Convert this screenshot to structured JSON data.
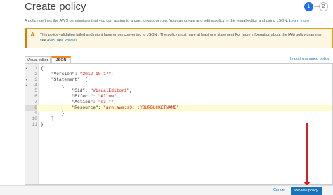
{
  "page": {
    "title": "Create policy"
  },
  "steps": {
    "step1": "1",
    "step2": "2"
  },
  "description": {
    "text": "A policy defines the AWS permissions that you can assign to a user, group, or role. You can create and edit a policy in the visual editor and using JSON.",
    "link": "Learn more"
  },
  "warning": {
    "text": "This policy validation failed and might have errors converting to JSON : The policy must have at least one statement For more information about the IAM policy grammar, see",
    "link": "AWS IAM Policies",
    "icon": "warning-icon"
  },
  "tabs": {
    "visual_editor": "Visual editor",
    "json": "JSON"
  },
  "import_link": "Import managed policy",
  "editor": {
    "lines": [
      {
        "num": "1",
        "fold": "▾",
        "text": "{"
      },
      {
        "num": "2",
        "fold": "",
        "text": "    \"Version\": ",
        "str": "\"2012-10-17\"",
        "tail": ","
      },
      {
        "num": "3",
        "fold": "▾",
        "text": "    \"Statement\": ["
      },
      {
        "num": "4",
        "fold": "▾",
        "text": "        {"
      },
      {
        "num": "5",
        "fold": "",
        "text": "            \"Sid\": ",
        "str": "\"VisualEditor1\"",
        "tail": ","
      },
      {
        "num": "6",
        "fold": "",
        "text": "            \"Effect\": ",
        "str": "\"Allow\"",
        "tail": ","
      },
      {
        "num": "7",
        "fold": "",
        "text": "            \"Action\": ",
        "str": "\"s3:*\"",
        "tail": ","
      },
      {
        "num": "8",
        "fold": "",
        "text": "            \"Resource\": ",
        "str": "\"arn:aws:s3:::YOURBUCKETNAME\"",
        "tail": ""
      },
      {
        "num": "9",
        "fold": "",
        "text": "        }"
      },
      {
        "num": "10",
        "fold": "",
        "text": "    ]"
      },
      {
        "num": "11",
        "fold": "",
        "text": "}"
      }
    ],
    "active_line": "8"
  },
  "footer": {
    "cancel": "Cancel",
    "review": "Review policy"
  },
  "colors": {
    "accent": "#1a73b8",
    "warning_border": "#e07b00",
    "annotation_arrow": "#d42020"
  }
}
